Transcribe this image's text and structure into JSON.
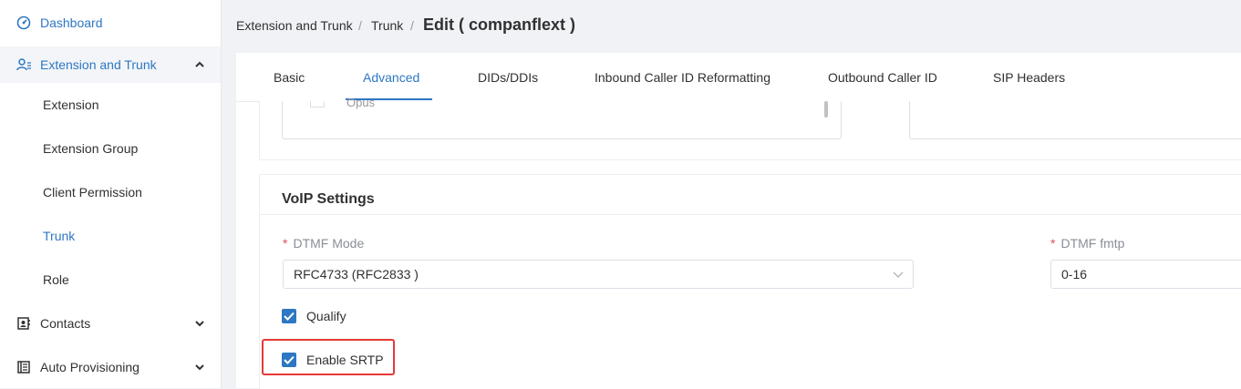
{
  "sidebar": {
    "items": [
      {
        "label": "Dashboard",
        "icon": "dashboard-icon"
      },
      {
        "label": "Extension and Trunk",
        "icon": "users-icon",
        "expanded": true
      },
      {
        "label": "Extension"
      },
      {
        "label": "Extension Group"
      },
      {
        "label": "Client Permission"
      },
      {
        "label": "Trunk",
        "active": true
      },
      {
        "label": "Role"
      },
      {
        "label": "Contacts",
        "icon": "contacts-icon"
      },
      {
        "label": "Auto Provisioning",
        "icon": "provisioning-icon"
      }
    ]
  },
  "breadcrumb": {
    "item1": "Extension and Trunk",
    "item2": "Trunk",
    "separator": "/",
    "current": "Edit ( companflext )"
  },
  "tabs": [
    "Basic",
    "Advanced",
    "DIDs/DDIs",
    "Inbound Caller ID Reformatting",
    "Outbound Caller ID",
    "SIP Headers"
  ],
  "active_tab": "Advanced",
  "codec_list": {
    "partial_item": "Opus"
  },
  "voip": {
    "title": "VoIP Settings",
    "dtmf_mode_label": "DTMF Mode",
    "dtmf_mode_value": "RFC4733 (RFC2833 )",
    "dtmf_fmtp_label": "DTMF fmtp",
    "dtmf_fmtp_value": "0-16",
    "required_mark": "*",
    "qualify_label": "Qualify",
    "qualify_checked": true,
    "srtp_label": "Enable SRTP",
    "srtp_checked": true
  },
  "colors": {
    "accent": "#2d77c3",
    "highlight": "#e53935",
    "required": "#e34d59"
  }
}
